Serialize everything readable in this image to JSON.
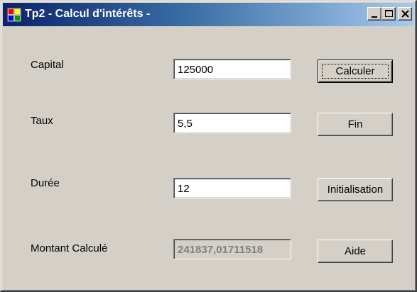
{
  "window": {
    "title": "Tp2 - Calcul d'intérêts -"
  },
  "titlebar_buttons": {
    "minimize": "minimize",
    "maximize": "maximize",
    "close": "close"
  },
  "form": {
    "fields": [
      {
        "label": "Capital",
        "value": "125000"
      },
      {
        "label": "Taux",
        "value": "5,5"
      },
      {
        "label": "Durée",
        "value": "12"
      },
      {
        "label": "Montant Calculé",
        "value": "241837,01711518"
      }
    ]
  },
  "buttons": {
    "calculer": "Calculer",
    "fin": "Fin",
    "initialisation": "Initialisation",
    "aide": "Aide"
  },
  "colors": {
    "face": "#d4d0c8",
    "title_start": "#0a246a",
    "title_end": "#a6caf0"
  }
}
